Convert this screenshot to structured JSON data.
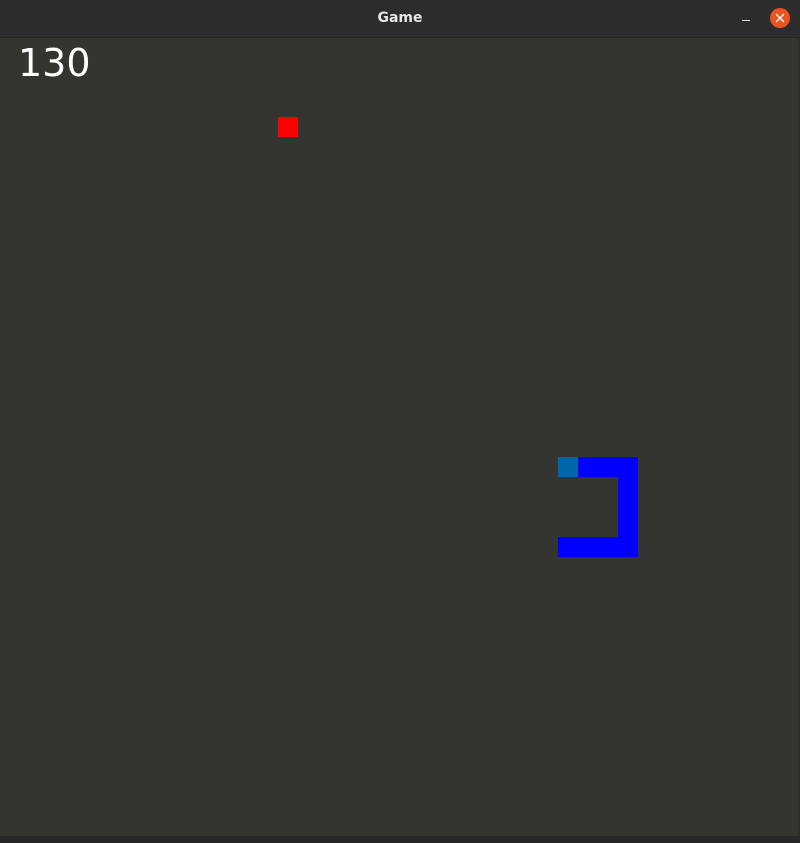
{
  "window": {
    "title": "Game",
    "minimize_icon": "minimize-icon",
    "close_icon": "close-icon",
    "accent": "#e95420"
  },
  "game": {
    "score": "130",
    "background": "#343431",
    "food_color": "#ff0000",
    "snake_color": "#0000ff",
    "snake_head_color": "#0066aa",
    "grid_cell": 20,
    "food_cell": [
      14,
      4
    ],
    "snake_cells": [
      [
        28,
        21
      ],
      [
        29,
        21
      ],
      [
        30,
        21
      ],
      [
        31,
        21
      ],
      [
        31,
        22
      ],
      [
        31,
        23
      ],
      [
        31,
        24
      ],
      [
        31,
        25
      ],
      [
        30,
        25
      ],
      [
        29,
        25
      ],
      [
        28,
        25
      ]
    ]
  }
}
